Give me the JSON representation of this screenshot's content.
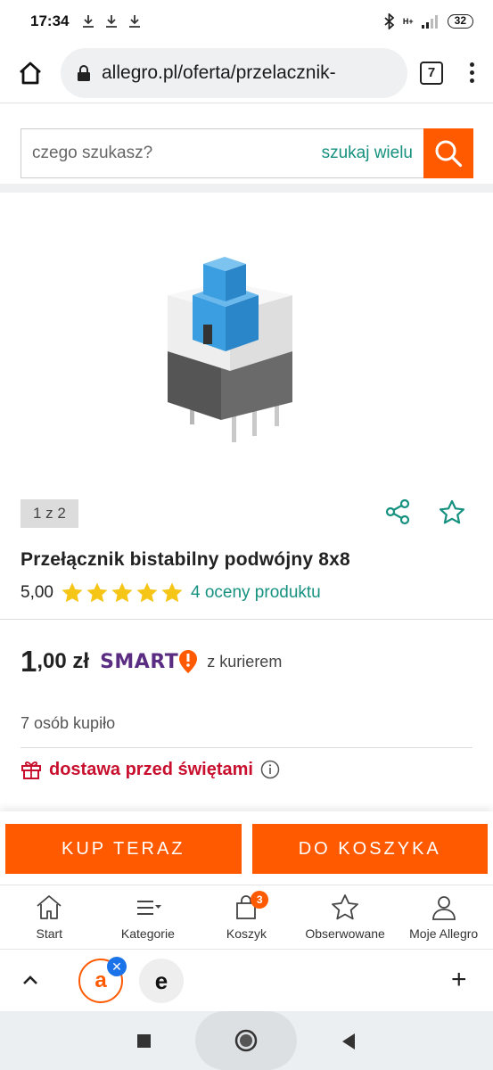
{
  "status_bar": {
    "time": "17:34",
    "network": "H+",
    "battery": "32"
  },
  "browser": {
    "url": "allegro.pl/oferta/przelacznik-",
    "tab_count": "7"
  },
  "search": {
    "placeholder": "czego szukasz?",
    "multi_search": "szukaj wielu"
  },
  "gallery": {
    "counter": "1 z 2"
  },
  "product": {
    "title": "Przełącznik bistabilny podwójny 8x8",
    "rating": "5,00",
    "stars": 5,
    "rating_link": "4 oceny produktu",
    "price_int": "1",
    "price_frac": ",00 zł",
    "smart_label": "SMART",
    "courier_label": "z kurierem",
    "buyers": "7 osób kupiło",
    "delivery": "dostawa przed świętami"
  },
  "actions": {
    "buy_now": "KUP TERAZ",
    "add_to_cart": "DO KOSZYKA"
  },
  "bottom_nav": {
    "items": [
      {
        "label": "Start",
        "icon": "home-icon"
      },
      {
        "label": "Kategorie",
        "icon": "menu-icon"
      },
      {
        "label": "Koszyk",
        "icon": "cart-icon"
      },
      {
        "label": "Obserwowane",
        "icon": "star-icon"
      },
      {
        "label": "Moje Allegro",
        "icon": "user-icon"
      }
    ],
    "cart_badge": "3"
  },
  "tab_strip": {
    "tab_a_letter": "a",
    "tab_e_letter": "e"
  },
  "colors": {
    "accent": "#ff5a00",
    "teal": "#16917f",
    "smart_purple": "#5a2d82",
    "delivery_red": "#c8102e",
    "star_yellow": "#f5c518"
  }
}
